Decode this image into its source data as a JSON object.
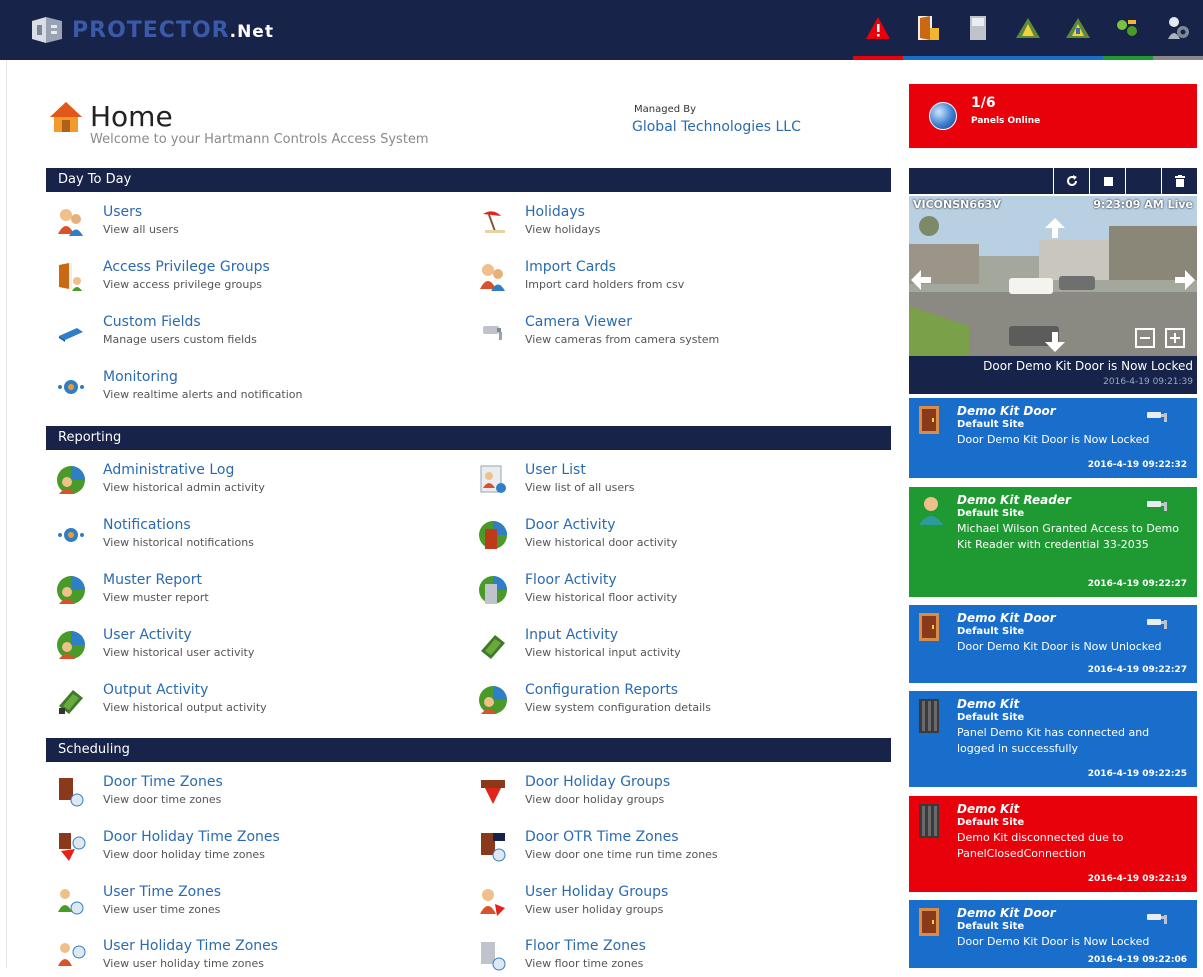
{
  "header": {
    "brand_main": "PROTECTOR",
    "brand_suffix": ".Net",
    "icons": [
      {
        "name": "alert-icon",
        "underline": "#e8000a"
      },
      {
        "name": "door-icon",
        "underline": "#1a6ecb"
      },
      {
        "name": "panel-icon",
        "underline": "#1a6ecb"
      },
      {
        "name": "input-icon",
        "underline": "#1a6ecb"
      },
      {
        "name": "output-icon",
        "underline": "#1a6ecb"
      },
      {
        "name": "network-icon",
        "underline": "#1f9a32"
      },
      {
        "name": "settings-icon",
        "underline": "#888888"
      }
    ]
  },
  "page": {
    "title": "Home",
    "subtitle": "Welcome to your Hartmann Controls Access System",
    "managed_by_label": "Managed By",
    "managed_by_name": "Global Technologies LLC"
  },
  "sections": {
    "day_to_day": {
      "label": "Day To Day",
      "items": [
        {
          "title": "Users",
          "desc": "View all users",
          "icon": "users-icon"
        },
        {
          "title": "Holidays",
          "desc": "View holidays",
          "icon": "holiday-icon"
        },
        {
          "title": "Access Privilege Groups",
          "desc": "View access privilege groups",
          "icon": "access-group-icon"
        },
        {
          "title": "Import Cards",
          "desc": "Import card holders from csv",
          "icon": "import-cards-icon"
        },
        {
          "title": "Custom Fields",
          "desc": "Manage users custom fields",
          "icon": "custom-fields-icon"
        },
        {
          "title": "Camera Viewer",
          "desc": "View cameras from camera system",
          "icon": "camera-icon"
        },
        {
          "title": "Monitoring",
          "desc": "View realtime alerts and notification",
          "icon": "monitoring-icon"
        }
      ]
    },
    "reporting": {
      "label": "Reporting",
      "items": [
        {
          "title": "Administrative Log",
          "desc": "View historical admin activity",
          "icon": "admin-log-icon"
        },
        {
          "title": "User List",
          "desc": "View list of all users",
          "icon": "user-list-icon"
        },
        {
          "title": "Notifications",
          "desc": "View historical notifications",
          "icon": "notifications-icon"
        },
        {
          "title": "Door Activity",
          "desc": "View historical door activity",
          "icon": "door-activity-icon"
        },
        {
          "title": "Muster Report",
          "desc": "View muster report",
          "icon": "muster-report-icon"
        },
        {
          "title": "Floor Activity",
          "desc": "View historical floor activity",
          "icon": "floor-activity-icon"
        },
        {
          "title": "User Activity",
          "desc": "View historical user activity",
          "icon": "user-activity-icon"
        },
        {
          "title": "Input Activity",
          "desc": "View historical input activity",
          "icon": "input-activity-icon"
        },
        {
          "title": "Output Activity",
          "desc": "View historical output activity",
          "icon": "output-activity-icon"
        },
        {
          "title": "Configuration Reports",
          "desc": "View system configuration details",
          "icon": "config-reports-icon"
        }
      ]
    },
    "scheduling": {
      "label": "Scheduling",
      "items": [
        {
          "title": "Door Time Zones",
          "desc": "View door time zones",
          "icon": "door-time-zones-icon"
        },
        {
          "title": "Door Holiday Groups",
          "desc": "View door holiday groups",
          "icon": "door-holiday-groups-icon"
        },
        {
          "title": "Door Holiday Time Zones",
          "desc": "View door holiday time zones",
          "icon": "door-holiday-time-zones-icon"
        },
        {
          "title": "Door OTR Time Zones",
          "desc": "View door one time run time zones",
          "icon": "door-otr-icon"
        },
        {
          "title": "User Time Zones",
          "desc": "View user time zones",
          "icon": "user-time-zones-icon"
        },
        {
          "title": "User Holiday Groups",
          "desc": "View user holiday groups",
          "icon": "user-holiday-groups-icon"
        },
        {
          "title": "User Holiday Time Zones",
          "desc": "View user holiday time zones",
          "icon": "user-holiday-time-zones-icon"
        },
        {
          "title": "Floor Time Zones",
          "desc": "View floor time zones",
          "icon": "floor-time-zones-icon"
        }
      ]
    }
  },
  "panels_status": {
    "count": "1/6",
    "label": "Panels Online",
    "color": "#e8000a"
  },
  "camera": {
    "name": "VICONSN663V",
    "time": "9:23:09 AM Live",
    "caption": "Door Demo Kit Door is Now Locked",
    "caption_time": "2016-4-19 09:21:39",
    "toolbar": [
      "refresh-icon",
      "stop-icon",
      "trash-icon"
    ]
  },
  "events": [
    {
      "name": "Demo Kit Door",
      "site": "Default Site",
      "message": "Door Demo Kit Door is Now Locked",
      "time": "2016-4-19 09:22:32",
      "color": "blue",
      "icon": "door-icon"
    },
    {
      "name": "Demo Kit Reader",
      "site": "Default Site",
      "message": "Michael Wilson Granted Access to Demo Kit Reader with credential 33-2035",
      "time": "2016-4-19 09:22:27",
      "color": "green",
      "icon": "user-icon"
    },
    {
      "name": "Demo Kit Door",
      "site": "Default Site",
      "message": "Door Demo Kit Door is Now Unlocked",
      "time": "2016-4-19 09:22:27",
      "color": "blue",
      "icon": "door-icon"
    },
    {
      "name": "Demo Kit",
      "site": "Default Site",
      "message": "Panel Demo Kit has connected and logged in successfully",
      "time": "2016-4-19 09:22:25",
      "color": "blue",
      "icon": "panel-icon"
    },
    {
      "name": "Demo Kit",
      "site": "Default Site",
      "message": "Demo Kit disconnected due to PanelClosedConnection",
      "time": "2016-4-19 09:22:19",
      "color": "red",
      "icon": "panel-icon"
    },
    {
      "name": "Demo Kit Door",
      "site": "Default Site",
      "message": "Door Demo Kit Door is Now Locked",
      "time": "2016-4-19 09:22:06",
      "color": "blue",
      "icon": "door-icon"
    }
  ]
}
